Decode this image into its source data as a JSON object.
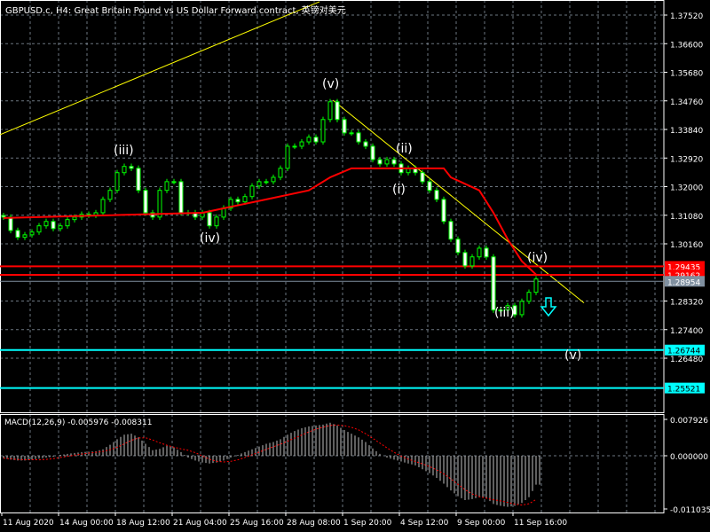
{
  "title": "GBPUSD.c, H4:  Great Britain Pound vs US Dollar Forward contract, 英镑对美元",
  "macd_label": "MACD(12,26,9) -0.005976 -0.008311",
  "colors": {
    "bg": "#000000",
    "grid": "#9aa8b8",
    "candle": "#00ff00",
    "ma": "#ff0000",
    "trend": "#ffff00",
    "level_red": "#ff0000",
    "level_cyan": "#00ffff",
    "current": "#8090a0",
    "signal": "#ff0000",
    "hist": "#c0c0c0"
  },
  "wave_labels": [
    "(iii)",
    "(iv)",
    "(v)",
    "(ii)",
    "(i)",
    "(iv)",
    "(iii)",
    "(v)"
  ],
  "arrow_icon": "down-arrow-icon",
  "chart_data": {
    "type": "candlestick",
    "symbol": "GBPUSD.c",
    "timeframe": "H4",
    "ylim": [
      1.248,
      1.3797
    ],
    "y_ticks": [
      "1.37520",
      "1.36600",
      "1.35680",
      "1.34760",
      "1.33840",
      "1.32920",
      "1.32000",
      "1.31080",
      "1.30160",
      "1.28320",
      "1.27400",
      "1.26480"
    ],
    "x_ticks": [
      "11 Aug 2020",
      "14 Aug 00:00",
      "18 Aug 12:00",
      "21 Aug 04:00",
      "25 Aug 16:00",
      "28 Aug 08:00",
      "1 Sep 20:00",
      "4 Sep 12:00",
      "9 Sep 00:00",
      "11 Sep 16:00"
    ],
    "closes": [
      1.3102,
      1.3059,
      1.3037,
      1.3045,
      1.3054,
      1.3074,
      1.3088,
      1.3065,
      1.3074,
      1.3094,
      1.3102,
      1.3111,
      1.3108,
      1.3116,
      1.3159,
      1.3188,
      1.3245,
      1.3265,
      1.3259,
      1.3188,
      1.3116,
      1.3102,
      1.3188,
      1.3216,
      1.3216,
      1.3116,
      1.3116,
      1.3102,
      1.3116,
      1.3074,
      1.3102,
      1.3131,
      1.3159,
      1.3151,
      1.3168,
      1.3202,
      1.3216,
      1.3216,
      1.323,
      1.3259,
      1.333,
      1.333,
      1.3344,
      1.3359,
      1.3344,
      1.3416,
      1.3473,
      1.3416,
      1.3373,
      1.3373,
      1.3344,
      1.333,
      1.3287,
      1.3273,
      1.3287,
      1.3273,
      1.3245,
      1.3259,
      1.3245,
      1.3216,
      1.3188,
      1.3159,
      1.3088,
      1.3031,
      1.2988,
      1.2945,
      1.2974,
      1.3002,
      1.2974,
      1.2803,
      1.2803,
      1.2817,
      1.2788,
      1.2831,
      1.286,
      1.2903
    ],
    "moving_average": [
      [
        0,
        1.3099
      ],
      [
        28,
        1.3116
      ],
      [
        37,
        1.3159
      ],
      [
        43,
        1.3188
      ],
      [
        46,
        1.323
      ],
      [
        49,
        1.3259
      ],
      [
        62,
        1.3259
      ],
      [
        63,
        1.323
      ],
      [
        67,
        1.3188
      ],
      [
        69,
        1.3116
      ],
      [
        71,
        1.3031
      ],
      [
        73,
        1.296
      ],
      [
        75,
        1.2917
      ]
    ],
    "trendlines": [
      [
        [
          -0.5,
          1.3367
        ],
        [
          44.5,
          1.3795
        ]
      ],
      [
        [
          46.4,
          1.3478
        ],
        [
          81.75,
          1.2826
        ]
      ]
    ],
    "levels": [
      {
        "price": 1.29435,
        "label": "1.29435",
        "kind": "red"
      },
      {
        "price": 1.29162,
        "label": "1.29162",
        "kind": "red"
      },
      {
        "price": 1.28954,
        "label": "1.28954",
        "kind": "current"
      },
      {
        "price": 1.26744,
        "label": "1.26744",
        "kind": "cyan"
      },
      {
        "price": 1.25521,
        "label": "1.25521",
        "kind": "cyan"
      }
    ],
    "macd": {
      "params": "12,26,9",
      "value": -0.005976,
      "signal_value": -0.008311,
      "ylim": [
        -0.011035,
        0.007926
      ],
      "y_ticks": [
        "0.007926",
        "0.000000",
        "-0.011035"
      ],
      "histogram": [
        -0.0005,
        -0.0008,
        -0.001,
        -0.001,
        -0.0008,
        -0.0006,
        -0.0004,
        -0.0002,
        0.0002,
        0.0004,
        0.0006,
        0.0008,
        0.0009,
        0.001,
        0.0014,
        0.0024,
        0.0036,
        0.0046,
        0.0048,
        0.004,
        0.0026,
        0.0012,
        0.0015,
        0.0022,
        0.0018,
        0.0008,
        -0.0004,
        -0.001,
        -0.0014,
        -0.0016,
        -0.0014,
        -0.001,
        -0.0004,
        0.0002,
        0.0008,
        0.0014,
        0.002,
        0.0026,
        0.003,
        0.0036,
        0.0046,
        0.0054,
        0.006,
        0.0064,
        0.0066,
        0.0068,
        0.0072,
        0.0066,
        0.0056,
        0.0048,
        0.004,
        0.003,
        0.0016,
        0.0004,
        -0.0004,
        -0.0008,
        -0.0012,
        -0.0016,
        -0.002,
        -0.0028,
        -0.0036,
        -0.0046,
        -0.0058,
        -0.0072,
        -0.0084,
        -0.0092,
        -0.009,
        -0.0086,
        -0.0088,
        -0.01,
        -0.0104,
        -0.0106,
        -0.0104,
        -0.0098,
        -0.0086,
        -0.006
      ]
    }
  }
}
